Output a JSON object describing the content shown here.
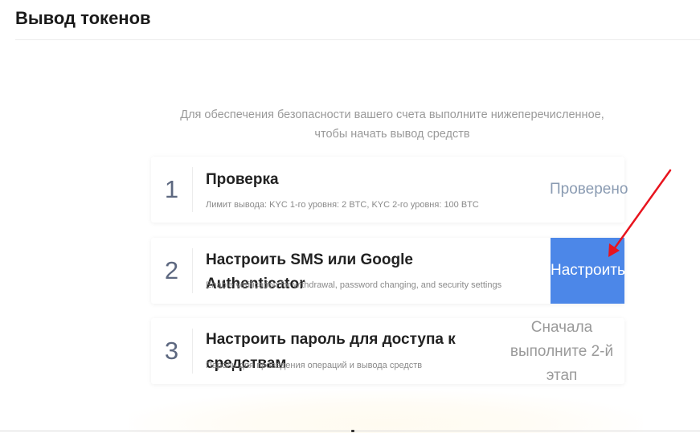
{
  "header": {
    "title": "Вывод токенов"
  },
  "intro": {
    "line1": "Для обеспечения безопасности вашего счета выполните нижеперечисленное,",
    "line2": "чтобы начать вывод средств"
  },
  "steps": [
    {
      "number": "1",
      "title": "Проверка",
      "description": "Лимит вывода: KYC 1-го уровня: 2 BTC, KYC 2-го уровня: 100 BTC",
      "status": "Проверено"
    },
    {
      "number": "2",
      "title": "Настроить SMS или Google Authenticator",
      "description": "Enable verification for withdrawal, password changing, and security settings",
      "action_label": "Настроить"
    },
    {
      "number": "3",
      "title": "Настроить пароль для доступа к средствам",
      "description": "Пароль для проведения операций и вывода средств",
      "status": "Сначала выполните 2-й этап"
    }
  ],
  "colors": {
    "accent": "#4c87e8",
    "verified": "#8a9bb2",
    "annotation_arrow": "#e8141e"
  }
}
